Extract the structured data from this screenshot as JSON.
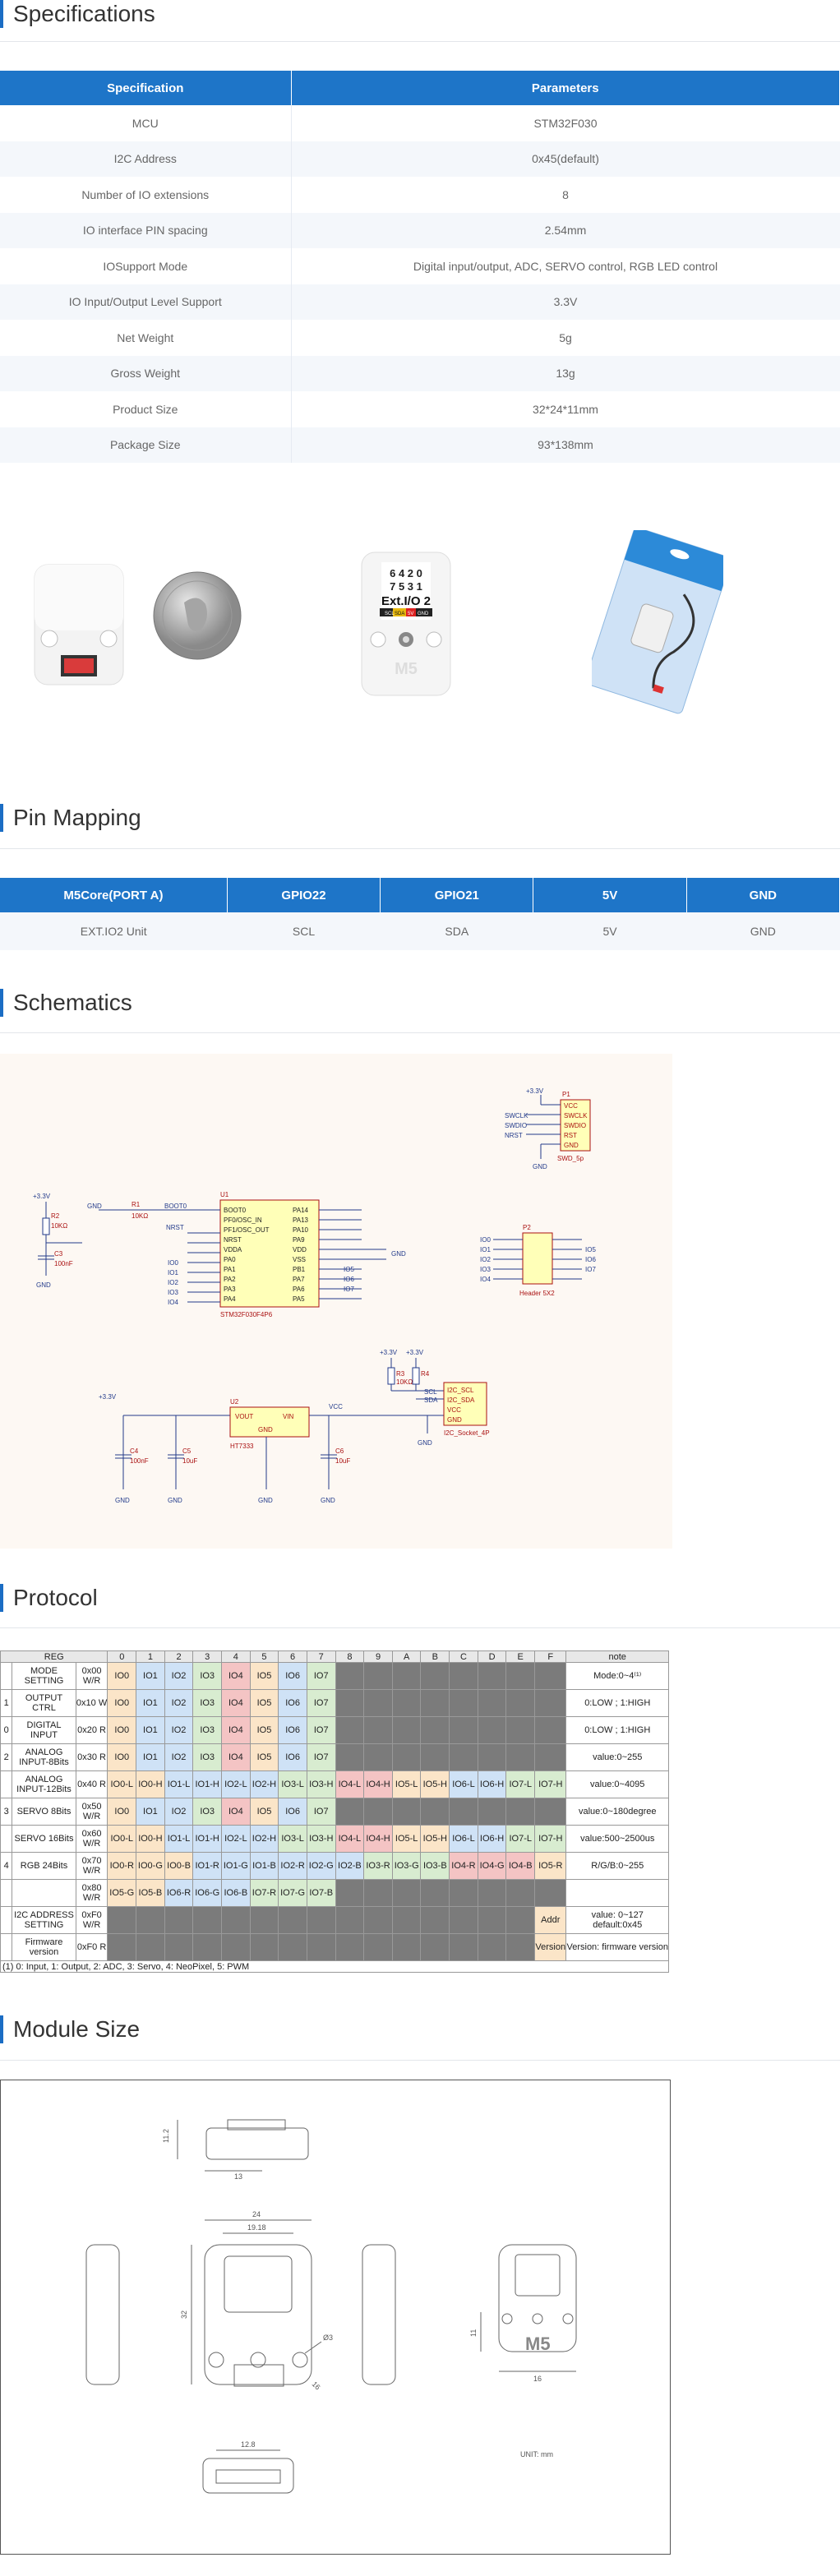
{
  "sections": {
    "specifications": "Specifications",
    "pin_mapping": "Pin Mapping",
    "schematics": "Schematics",
    "protocol": "Protocol",
    "module_size": "Module Size"
  },
  "spec_table": {
    "headers": [
      "Specification",
      "Parameters"
    ],
    "rows": [
      [
        "MCU",
        "STM32F030"
      ],
      [
        "I2C Address",
        "0x45(default)"
      ],
      [
        "Number of IO extensions",
        "8"
      ],
      [
        "IO interface PIN spacing",
        "2.54mm"
      ],
      [
        "IOSupport Mode",
        "Digital input/output, ADC, SERVO control, RGB LED control"
      ],
      [
        "IO Input/Output Level Support",
        "3.3V"
      ],
      [
        "Net Weight",
        "5g"
      ],
      [
        "Gross Weight",
        "13g"
      ],
      [
        "Product Size",
        "32*24*11mm"
      ],
      [
        "Package Size",
        "93*138mm"
      ]
    ]
  },
  "pin_table": {
    "headers": [
      "M5Core(PORT A)",
      "GPIO22",
      "GPIO21",
      "5V",
      "GND"
    ],
    "row": [
      "EXT.IO2 Unit",
      "SCL",
      "SDA",
      "5V",
      "GND"
    ]
  },
  "device_label": {
    "line1": "6 4 2 0",
    "line2": "7 5 3 1",
    "name": "Ext.I/O 2",
    "pins": [
      "SCL",
      "SDA",
      "5V",
      "GND"
    ],
    "logo": "M5"
  },
  "protocol": {
    "header": [
      "REG",
      "0",
      "1",
      "2",
      "3",
      "4",
      "5",
      "6",
      "7",
      "8",
      "9",
      "A",
      "B",
      "C",
      "D",
      "E",
      "F",
      "note"
    ],
    "rows": [
      {
        "idx": "",
        "name": "MODE SETTING",
        "reg": "0x00 W/R",
        "cells": [
          "IO0",
          "IO1",
          "IO2",
          "IO3",
          "IO4",
          "IO5",
          "IO6",
          "IO7"
        ],
        "note": "Mode:0~4⁽¹⁾"
      },
      {
        "idx": "1",
        "name": "OUTPUT CTRL",
        "reg": "0x10 W",
        "cells": [
          "IO0",
          "IO1",
          "IO2",
          "IO3",
          "IO4",
          "IO5",
          "IO6",
          "IO7"
        ],
        "note": "0:LOW ; 1:HIGH"
      },
      {
        "idx": "0",
        "name": "DIGITAL INPUT",
        "reg": "0x20 R",
        "cells": [
          "IO0",
          "IO1",
          "IO2",
          "IO3",
          "IO4",
          "IO5",
          "IO6",
          "IO7"
        ],
        "note": "0:LOW ; 1:HIGH"
      },
      {
        "idx": "2",
        "name": "ANALOG INPUT-8Bits",
        "reg": "0x30 R",
        "cells": [
          "IO0",
          "IO1",
          "IO2",
          "IO3",
          "IO4",
          "IO5",
          "IO6",
          "IO7"
        ],
        "note": "value:0~255"
      },
      {
        "idx": "",
        "name": "ANALOG INPUT-12Bits",
        "reg": "0x40 R",
        "cells": [
          "IO0-L",
          "IO0-H",
          "IO1-L",
          "IO1-H",
          "IO2-L",
          "IO2-H",
          "IO3-L",
          "IO3-H",
          "IO4-L",
          "IO4-H",
          "IO5-L",
          "IO5-H",
          "IO6-L",
          "IO6-H",
          "IO7-L",
          "IO7-H"
        ],
        "note": "value:0~4095"
      },
      {
        "idx": "3",
        "name": "SERVO 8Bits",
        "reg": "0x50 W/R",
        "cells": [
          "IO0",
          "IO1",
          "IO2",
          "IO3",
          "IO4",
          "IO5",
          "IO6",
          "IO7"
        ],
        "note": "value:0~180degree"
      },
      {
        "idx": "",
        "name": "SERVO 16Bits",
        "reg": "0x60 W/R",
        "cells": [
          "IO0-L",
          "IO0-H",
          "IO1-L",
          "IO1-H",
          "IO2-L",
          "IO2-H",
          "IO3-L",
          "IO3-H",
          "IO4-L",
          "IO4-H",
          "IO5-L",
          "IO5-H",
          "IO6-L",
          "IO6-H",
          "IO7-L",
          "IO7-H"
        ],
        "note": "value:500~2500us"
      },
      {
        "idx": "4",
        "name": "RGB 24Bits",
        "reg": "0x70 W/R",
        "cells": [
          "IO0-R",
          "IO0-G",
          "IO0-B",
          "IO1-R",
          "IO1-G",
          "IO1-B",
          "IO2-R",
          "IO2-G",
          "IO2-B",
          "IO3-R",
          "IO3-G",
          "IO3-B",
          "IO4-R",
          "IO4-G",
          "IO4-B",
          "IO5-R"
        ],
        "note": "R/G/B:0~255"
      },
      {
        "idx": "",
        "name": "",
        "reg": "0x80 W/R",
        "cells": [
          "IO5-G",
          "IO5-B",
          "IO6-R",
          "IO6-G",
          "IO6-B",
          "IO7-R",
          "IO7-G",
          "IO7-B"
        ],
        "note": ""
      },
      {
        "idx": "",
        "name": "I2C ADDRESS SETTING",
        "reg": "0xF0 W/R",
        "cells": [],
        "last": "Addr",
        "note": "value: 0~127 default:0x45"
      },
      {
        "idx": "",
        "name": "Firmware version",
        "reg": "0xF0 R",
        "cells": [],
        "last": "Version",
        "note": "Version: firmware version"
      }
    ],
    "footnote": "(1) 0: Input, 1: Output, 2: ADC, 3: Servo, 4: NeoPixel, 5: PWM"
  },
  "schematic": {
    "u1": "U1",
    "u1_name": "STM32F030F4P6",
    "u1_left": [
      "BOOT0",
      "PF0/OSC_IN",
      "PF1/OSC_OUT",
      "NRST",
      "VDDA",
      "PA0",
      "PA1",
      "PA2",
      "PA3",
      "PA4"
    ],
    "u1_right": [
      "PA14",
      "PA13",
      "PA10",
      "PA9",
      "VDD",
      "VSS",
      "PB1",
      "PA7",
      "PA6",
      "PA5"
    ],
    "p1_pins": [
      "VCC",
      "SWCLK",
      "SWDIO",
      "RST",
      "GND"
    ],
    "p1_name": "SWD_5p",
    "p2_name": "Header 5X2",
    "u2": "U2",
    "u2_name": "HT7333",
    "u2_pins": [
      "VOUT",
      "VIN",
      "GND"
    ],
    "j1_pins": [
      "I2C_SCL",
      "I2C_SDA",
      "VCC",
      "GND"
    ],
    "j1_name": "I2C_Socket_4P",
    "v33": "+3.3V",
    "gnd": "GND",
    "vcc": "VCC",
    "r1": "R1",
    "r1v": "10KΩ",
    "r2": "R2",
    "r2v": "10KΩ",
    "c3": "C3",
    "c3v": "100nF",
    "c4": "C4",
    "c4v": "100nF",
    "c5": "C5",
    "c5v": "10uF",
    "c6": "C6",
    "c6v": "10uF",
    "r3": "R3",
    "r4": "R4",
    "r34v": "10KΩ",
    "boot": "BOOT0",
    "nrst": "NRST",
    "swclk": "SWCLK",
    "swdio": "SWDIO",
    "sda": "SDA",
    "scl": "SCL",
    "io": [
      "IO0",
      "IO1",
      "IO2",
      "IO3",
      "IO4",
      "IO5",
      "IO6",
      "IO7"
    ]
  },
  "module_size": {
    "dims": [
      "11.2",
      "13",
      "24",
      "19.18",
      "32",
      "Ø3",
      "11",
      "16",
      "16",
      "12.8"
    ],
    "unit": "UNIT: mm",
    "logo": "M5"
  }
}
